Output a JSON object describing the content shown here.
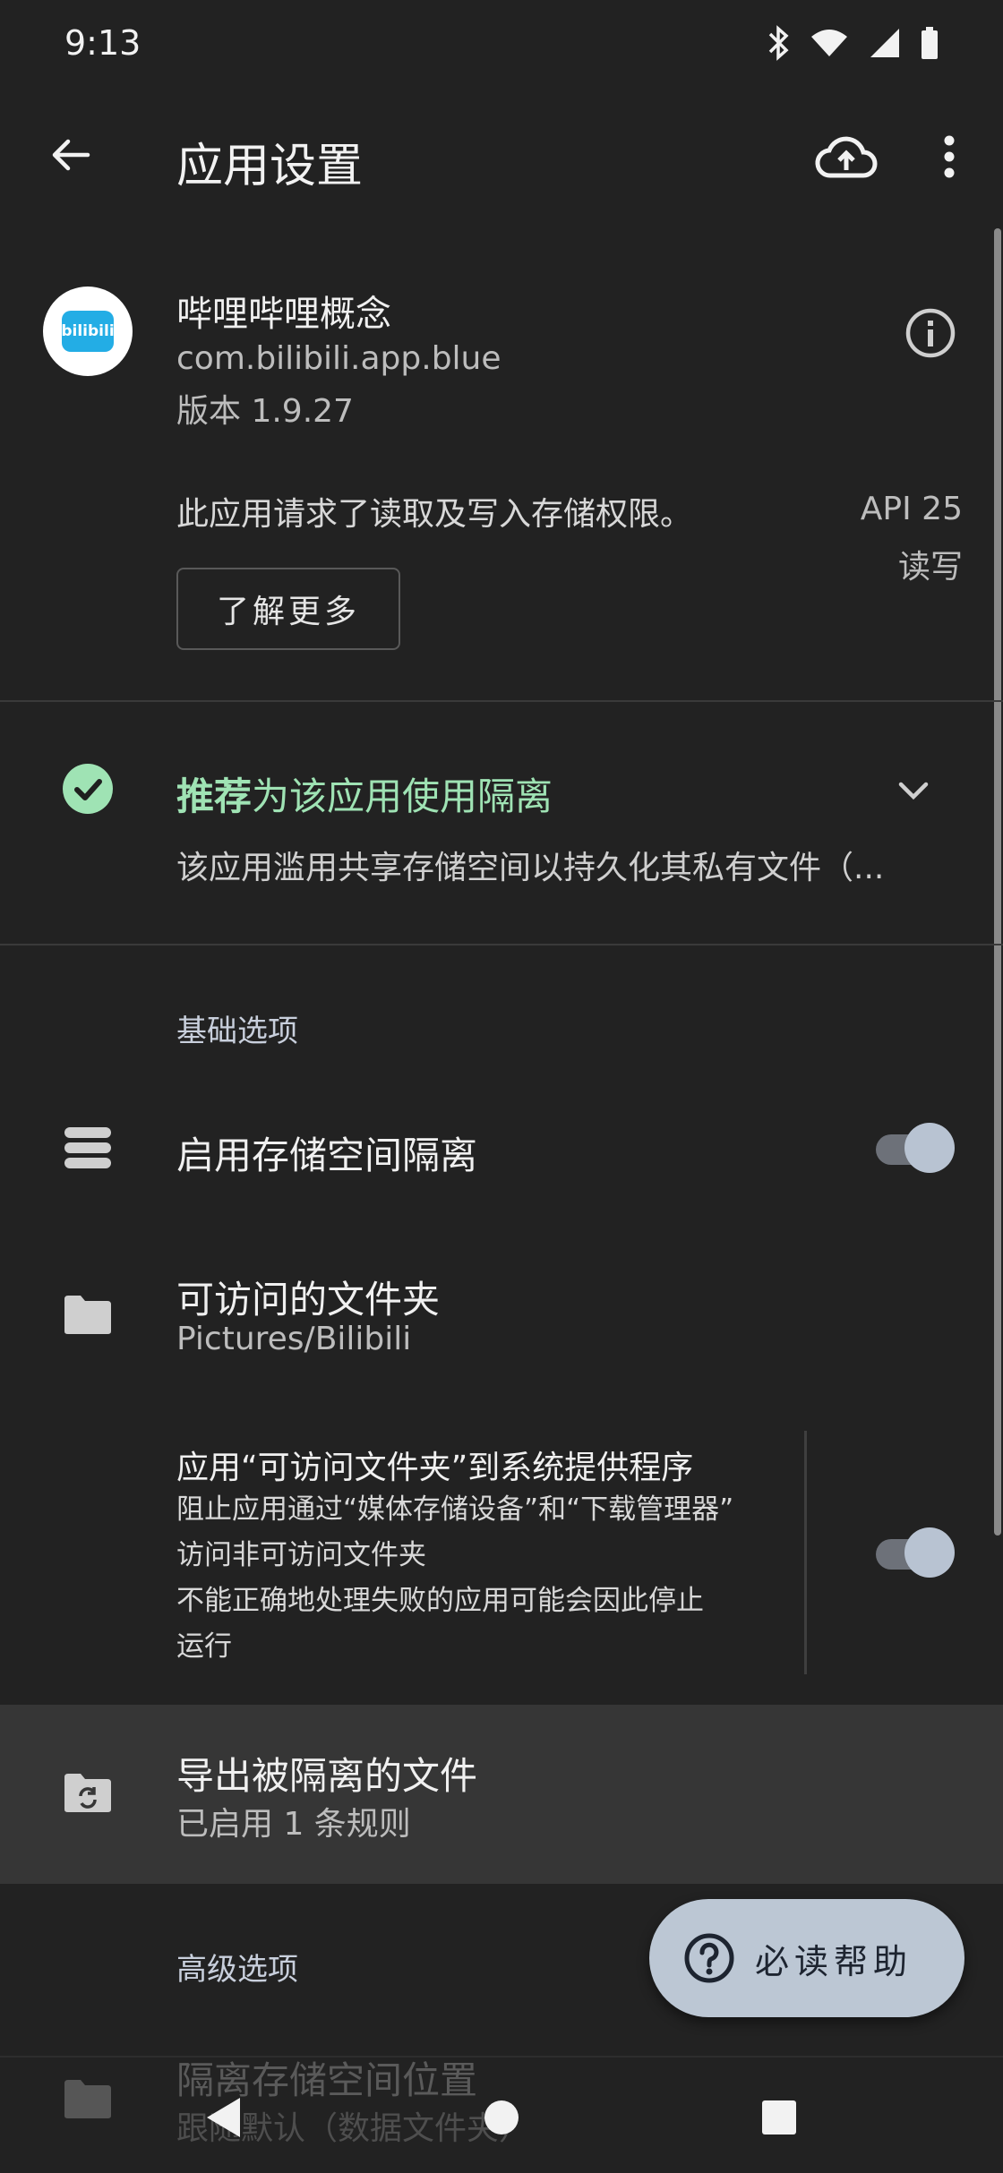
{
  "status_bar": {
    "time": "9:13",
    "icons": [
      "bluetooth-icon",
      "wifi-icon",
      "signal-icon",
      "battery-icon"
    ]
  },
  "app_bar": {
    "title": "应用设置",
    "actions": [
      "cloud-upload-icon",
      "more-vert-icon"
    ]
  },
  "app_info": {
    "name": "哔哩哔哩概念",
    "package": "com.bilibili.app.blue",
    "version": "版本 1.9.27",
    "icon_text": "bilibili"
  },
  "permission": {
    "text": "此应用请求了读取及写入存储权限。",
    "api": "API 25",
    "mode": "读写",
    "learn_more": "了解更多"
  },
  "recommendation": {
    "title_bold": "推荐",
    "title_rest": "为该应用使用隔离",
    "description": "该应用滥用共享存储空间以持久化其私有文件（..."
  },
  "basic": {
    "section_title": "基础选项",
    "enable_isolation": {
      "title": "启用存储空间隔离",
      "enabled": true
    },
    "accessible_folders": {
      "title": "可访问的文件夹",
      "value": "Pictures/Bilibili"
    },
    "apply_to_provider": {
      "title": "应用“可访问文件夹”到系统提供程序",
      "lines": [
        "阻止应用通过“媒体存储设备”和“下载管理器”",
        "访问非可访问文件夹",
        "不能正确地处理失败的应用可能会因此停止",
        "运行"
      ],
      "enabled": true
    },
    "export_files": {
      "title": "导出被隔离的文件",
      "value": "已启用 1 条规则"
    }
  },
  "advanced": {
    "section_title": "高级选项",
    "location": {
      "title": "隔离存储空间位置",
      "value": "跟随默认（数据文件夹）"
    }
  },
  "fab": {
    "label": "必读帮助"
  },
  "colors": {
    "background": "#222222",
    "accent_green": "#9fe3b4",
    "toggle_thumb": "#b8c3d2",
    "fab_background": "#bcc7d4",
    "highlight_row": "#363636"
  }
}
